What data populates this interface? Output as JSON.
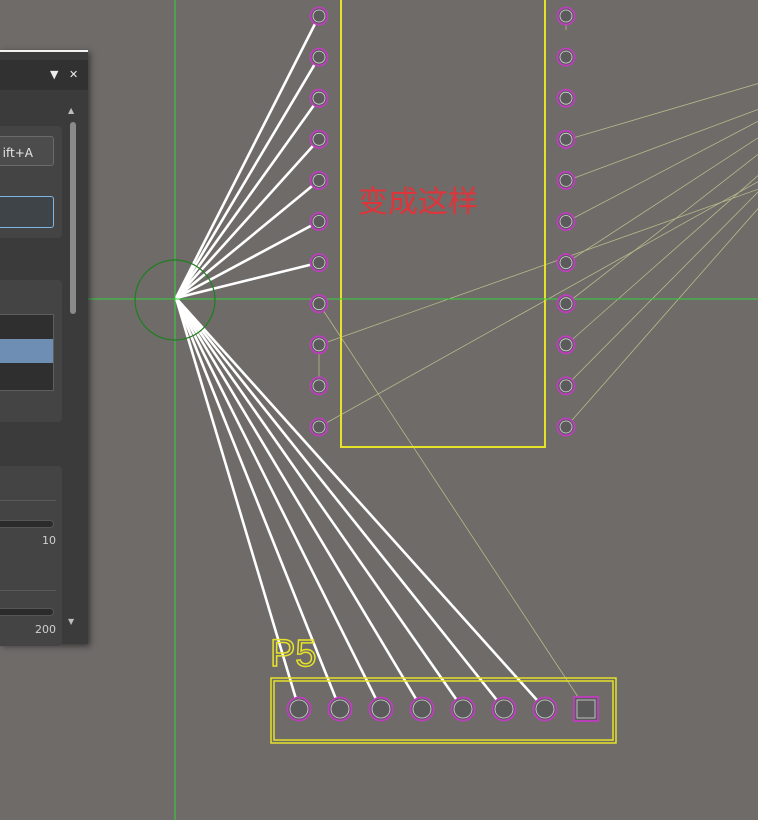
{
  "colors": {
    "canvas": "#6e6b69",
    "crosshair": "#37d13a",
    "silkscreen": "#e6e22a",
    "pad_outline": "#c13cc1",
    "pad_fill": "#5b5b5b",
    "ratsnest": "#b9b98a",
    "routed": "#ffffff",
    "annotation": "#e0343b"
  },
  "canvas": {
    "annotation_text": "变成这样",
    "designator": "P5"
  },
  "panel": {
    "dropdown_icon": "▼",
    "close_icon": "✕",
    "shortcut_label": "ift+A",
    "slider1_value": "10",
    "slider2_value": "200",
    "scroll_up_icon": "▲",
    "scroll_down_icon": "▼"
  }
}
